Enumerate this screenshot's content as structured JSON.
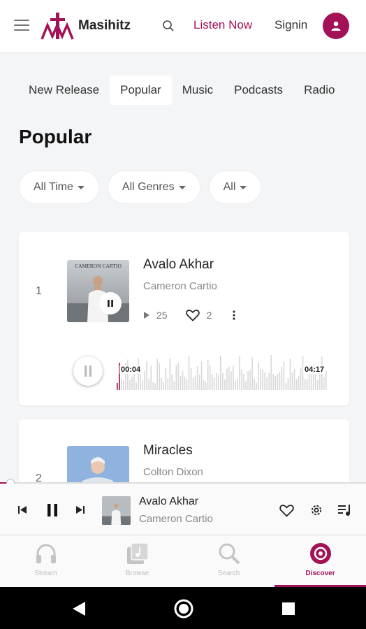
{
  "header": {
    "brand": "Masihitz",
    "listen_now": "Listen Now",
    "signin": "Signin"
  },
  "tabs": [
    {
      "label": "New Release",
      "active": false
    },
    {
      "label": "Popular",
      "active": true
    },
    {
      "label": "Music",
      "active": false
    },
    {
      "label": "Podcasts",
      "active": false
    },
    {
      "label": "Radio",
      "active": false
    }
  ],
  "page_title": "Popular",
  "filters": [
    {
      "label": "All Time"
    },
    {
      "label": "All Genres"
    },
    {
      "label": "All"
    }
  ],
  "tracks": [
    {
      "rank": "1",
      "title": "Avalo Akhar",
      "artist": "Cameron Cartio",
      "cover_text": "CAMERON CARTIO",
      "plays": "25",
      "likes": "2",
      "current_time": "00:04",
      "duration": "04:17",
      "progress": 0.016
    },
    {
      "rank": "2",
      "title": "Miracles",
      "artist": "Colton Dixon"
    }
  ],
  "player": {
    "title": "Avalo Akhar",
    "artist": "Cameron Cartio",
    "progress": 0.02
  },
  "bottom_nav": [
    {
      "label": "Stream",
      "icon": "headphones-icon",
      "active": false
    },
    {
      "label": "Browse",
      "icon": "music-library-icon",
      "active": false
    },
    {
      "label": "Search",
      "icon": "search-icon",
      "active": false
    },
    {
      "label": "Discover",
      "icon": "discover-icon",
      "active": true
    }
  ],
  "colors": {
    "accent": "#a31257",
    "background": "#f4f5f7",
    "muted_text": "#888888"
  }
}
